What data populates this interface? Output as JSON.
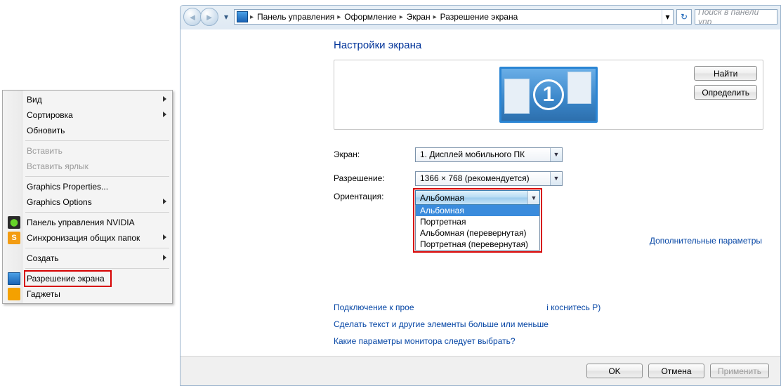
{
  "context_menu": {
    "items": [
      {
        "label": "Вид",
        "sub": true
      },
      {
        "label": "Сортировка",
        "sub": true
      },
      {
        "label": "Обновить"
      },
      {
        "sep": true
      },
      {
        "label": "Вставить",
        "disabled": true
      },
      {
        "label": "Вставить ярлык",
        "disabled": true
      },
      {
        "sep": true
      },
      {
        "label": "Graphics Properties..."
      },
      {
        "label": "Graphics Options",
        "sub": true
      },
      {
        "sep": true
      },
      {
        "label": "Панель управления NVIDIA",
        "icon": "nvidia"
      },
      {
        "label": "Синхронизация общих папок",
        "icon": "sync",
        "sub": true
      },
      {
        "sep": true
      },
      {
        "label": "Создать",
        "sub": true
      },
      {
        "sep": true
      },
      {
        "label": "Разрешение экрана",
        "icon": "screen",
        "highlight": true
      },
      {
        "label": "Гаджеты",
        "icon": "gadget"
      }
    ]
  },
  "address_bar": {
    "crumbs": [
      "Панель управления",
      "Оформление",
      "Экран",
      "Разрешение экрана"
    ],
    "search_placeholder": "Поиск в панели упр"
  },
  "page": {
    "title": "Настройки экрана",
    "monitor_number": "1",
    "find_btn": "Найти",
    "detect_btn": "Определить",
    "screen_label": "Экран:",
    "screen_value": "1. Дисплей мобильного ПК",
    "resolution_label": "Разрешение:",
    "resolution_value": "1366 × 768 (рекомендуется)",
    "orientation_label": "Ориентация:",
    "orientation_value": "Альбомная",
    "orientation_options": [
      "Альбомная",
      "Портретная",
      "Альбомная (перевернутая)",
      "Портретная (перевернутая)"
    ],
    "advanced_link": "Дополнительные параметры",
    "proj_prefix": "Подключение к прое",
    "proj_suffix": "і коснитесь P)",
    "text_size_link": "Сделать текст и другие элементы больше или меньше",
    "which_link": "Какие параметры монитора следует выбрать?"
  },
  "footer": {
    "ok": "OK",
    "cancel": "Отмена",
    "apply": "Применить"
  }
}
